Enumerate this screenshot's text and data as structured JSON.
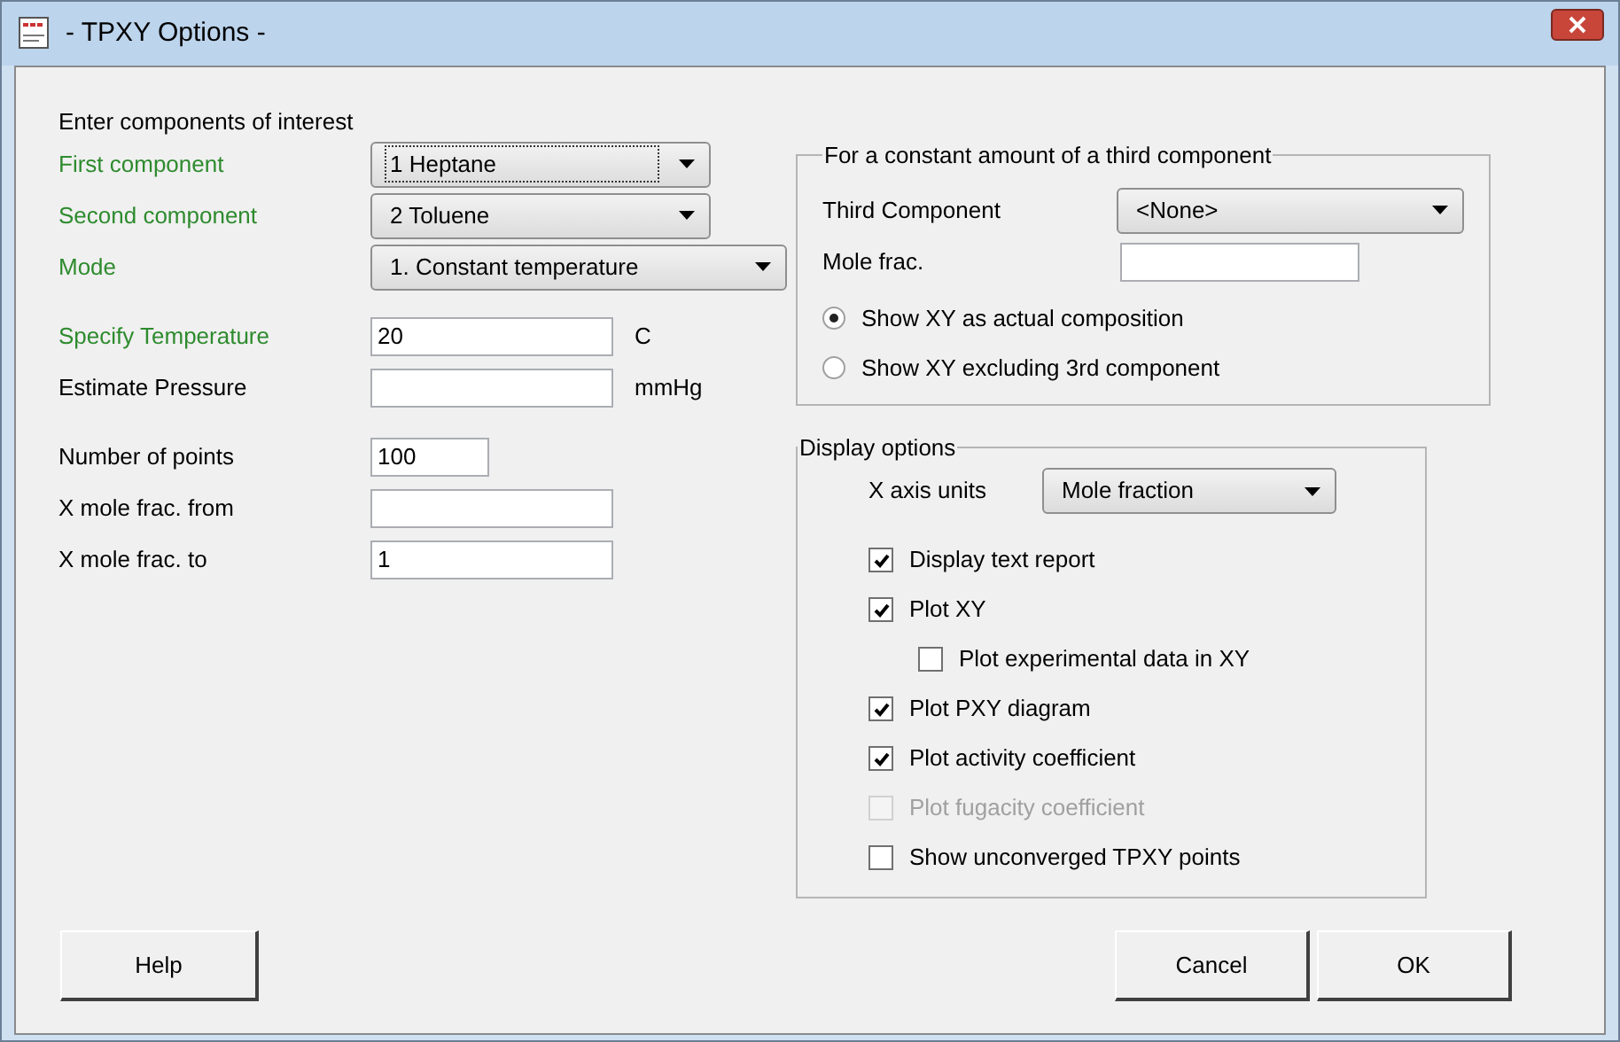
{
  "window": {
    "title": "- TPXY Options -"
  },
  "components": {
    "heading": "Enter components of interest",
    "groups": [
      [
        {
          "kind": "combo",
          "label": "First component",
          "value": "1 Heptane",
          "highlighted": true,
          "focused": true
        },
        {
          "kind": "combo",
          "label": "Second component",
          "value": "2 Toluene",
          "highlighted": true,
          "focused": false
        },
        {
          "kind": "combo",
          "label": "Mode",
          "value": "1. Constant temperature",
          "highlighted": true,
          "focused": false
        }
      ],
      [
        {
          "kind": "text",
          "label": "Specify Temperature",
          "value": "20",
          "unit": "C",
          "highlighted": true
        },
        {
          "kind": "text",
          "label": "Estimate Pressure",
          "unit": "mmHg",
          "highlighted": false
        }
      ],
      [
        {
          "kind": "text",
          "label": "Number of points",
          "value": "100",
          "highlighted": false
        },
        {
          "kind": "text",
          "label": "X mole frac. from",
          "highlighted": false
        },
        {
          "kind": "text",
          "label": "X mole frac. to",
          "value": "1",
          "highlighted": false
        }
      ]
    ]
  },
  "third_component": {
    "legend": "For a constant amount of a third component",
    "combo_label": "Third Component",
    "combo_value": "<None>",
    "mole_frac_label": "Mole frac.",
    "radios": [
      {
        "label": "Show XY as actual composition",
        "selected": true
      },
      {
        "label": "Show XY excluding 3rd component",
        "selected": false
      }
    ]
  },
  "display_options": {
    "legend": "Display options",
    "x_axis_label": "X axis units",
    "x_axis_value": "Mole fraction",
    "checkboxes": [
      {
        "label": "Display text report",
        "checked": true,
        "disabled": false
      },
      {
        "label": "Plot XY",
        "checked": true,
        "disabled": false,
        "children": [
          {
            "label": "Plot experimental data in XY",
            "checked": false,
            "disabled": false
          }
        ]
      },
      {
        "label": "Plot PXY diagram",
        "checked": true,
        "disabled": false
      },
      {
        "label": "Plot activity coefficient",
        "checked": true,
        "disabled": false
      },
      {
        "label": "Plot fugacity coefficient",
        "checked": false,
        "disabled": true
      },
      {
        "label": "Show unconverged TPXY points",
        "checked": false,
        "disabled": false
      }
    ]
  },
  "buttons": {
    "help": "Help",
    "cancel": "Cancel",
    "ok": "OK"
  }
}
